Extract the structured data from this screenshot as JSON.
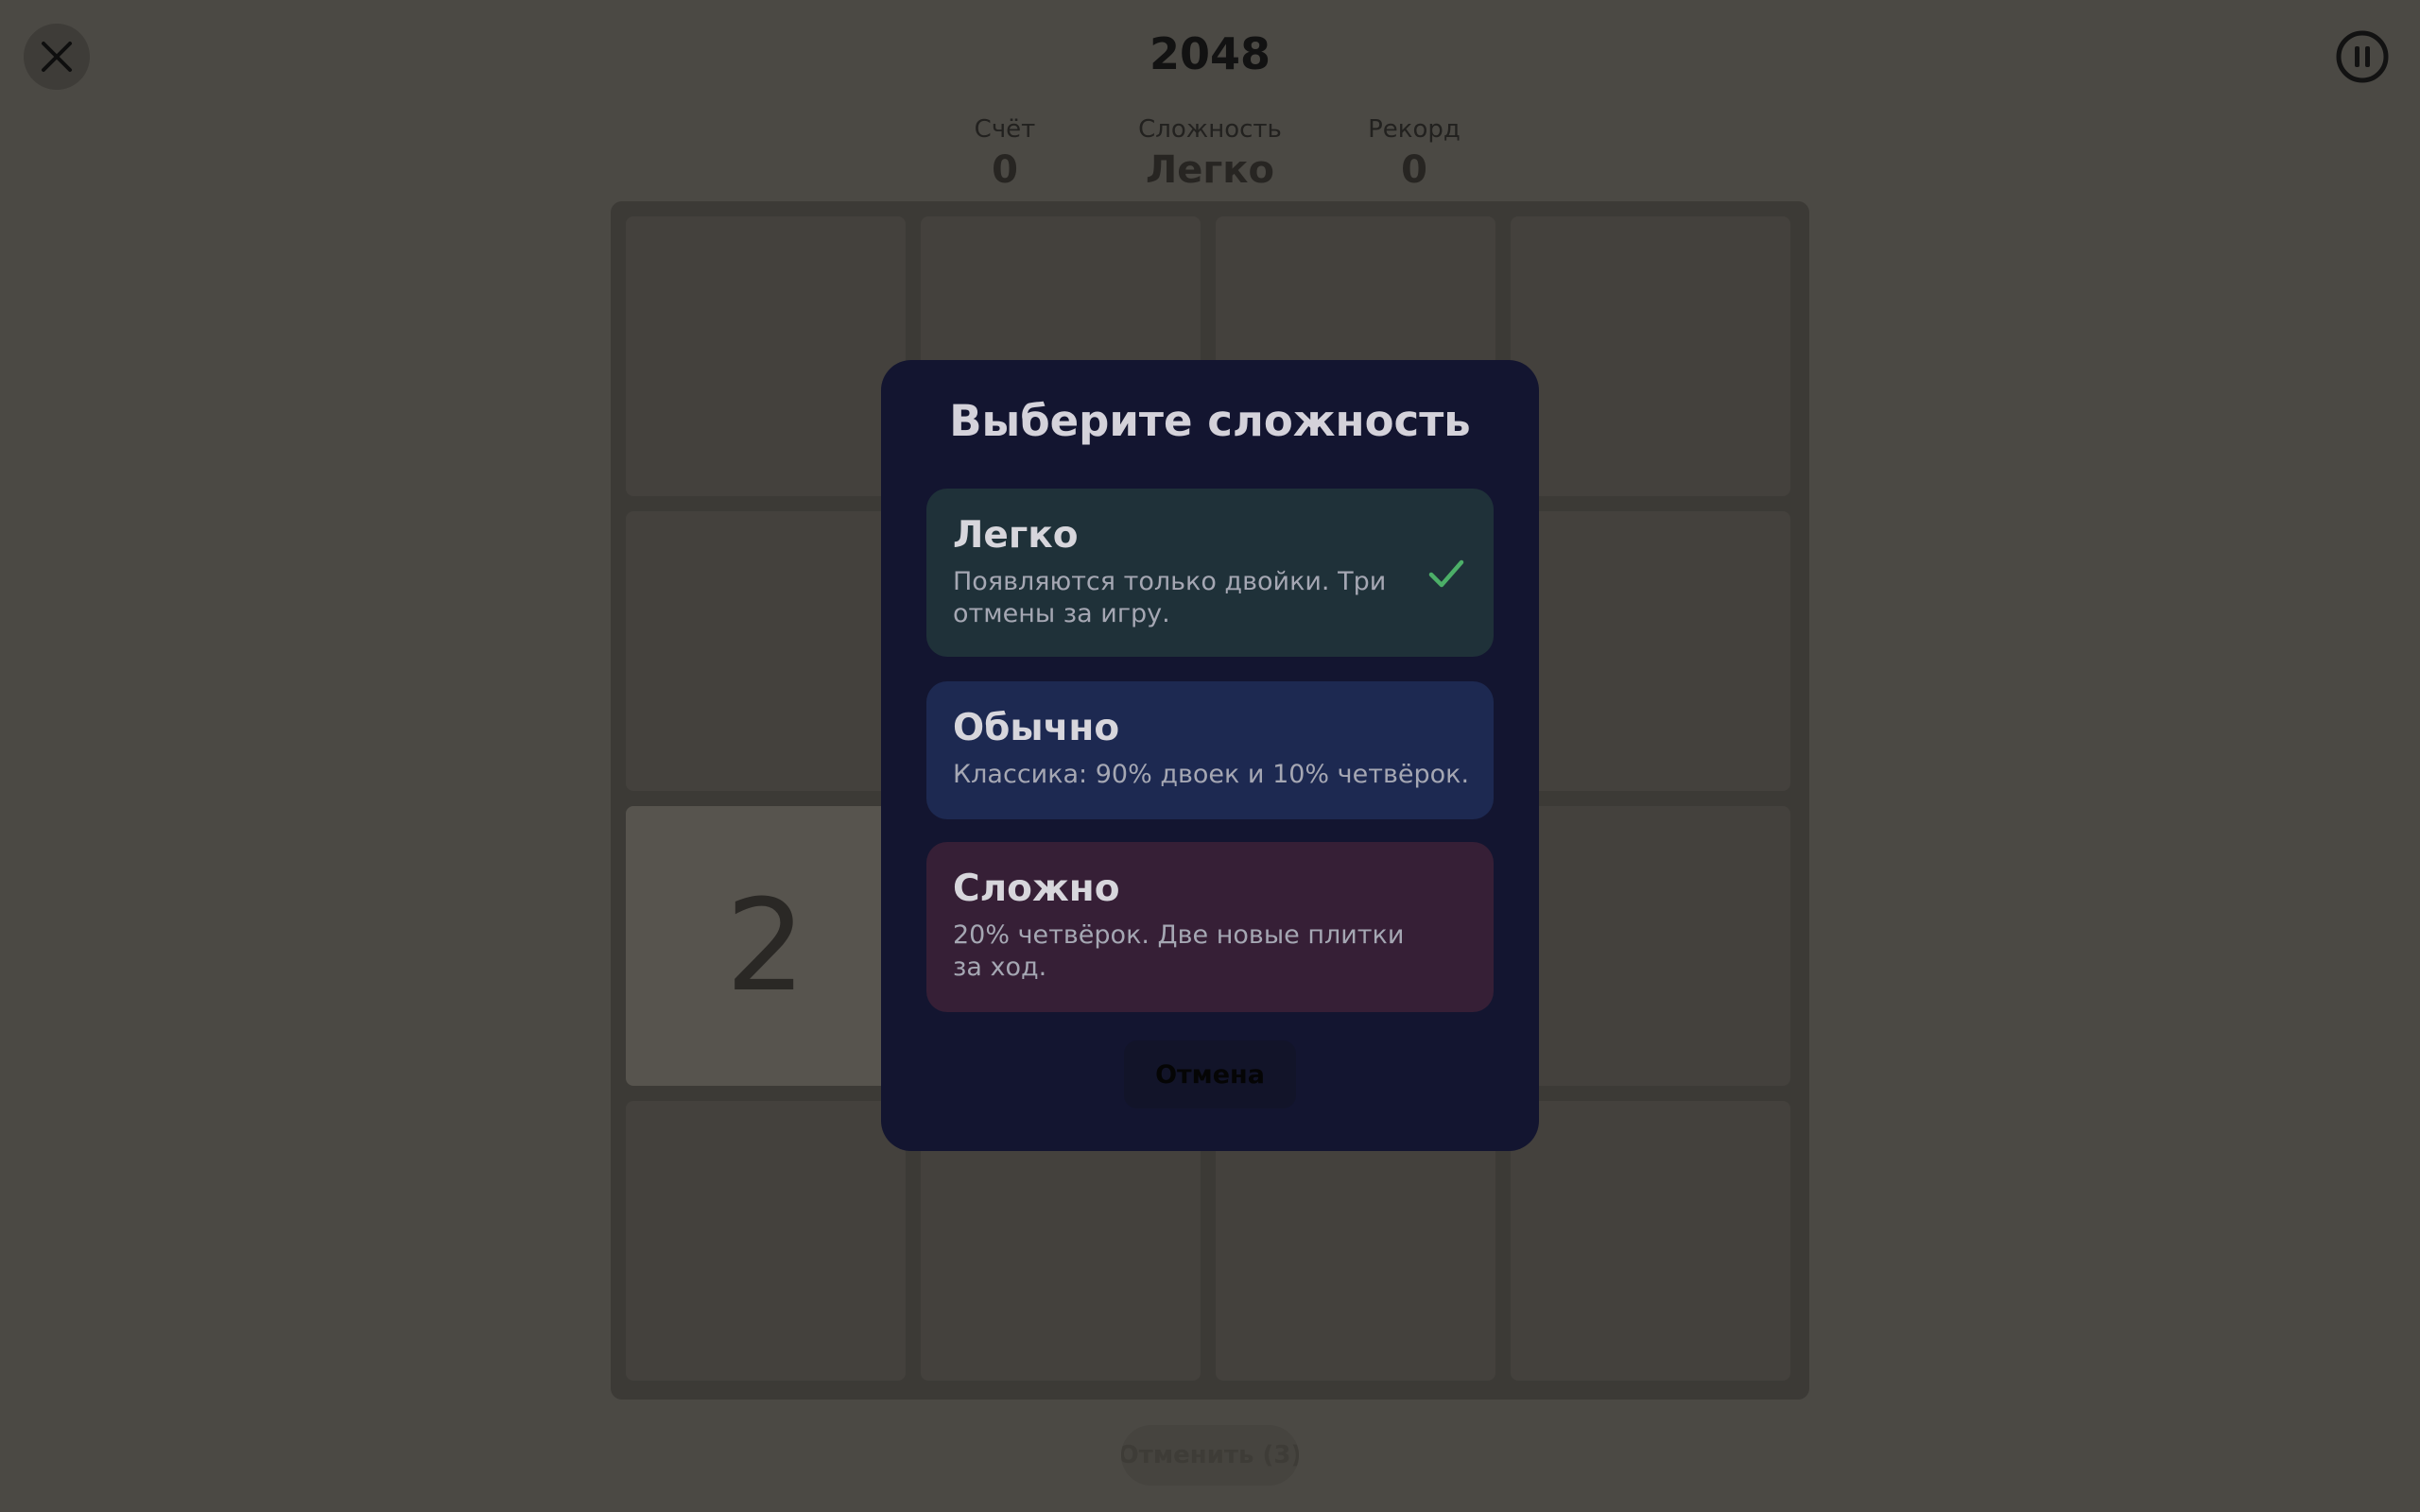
{
  "header": {
    "title": "2048",
    "close_icon": "close-icon",
    "pause_icon": "pause-icon"
  },
  "stats": {
    "score_label": "Счёт",
    "score_value": "0",
    "difficulty_label": "Сложность",
    "difficulty_value": "Легко",
    "record_label": "Рекорд",
    "record_value": "0"
  },
  "board": {
    "size": 4,
    "tiles": [
      [
        "",
        "",
        "",
        ""
      ],
      [
        "",
        "",
        "",
        ""
      ],
      [
        "2",
        "",
        "",
        ""
      ],
      [
        "",
        "",
        "",
        ""
      ]
    ]
  },
  "undo": {
    "label": "Отменить (3)"
  },
  "modal": {
    "title": "Выберите сложность",
    "options": [
      {
        "name": "Легко",
        "description": "Появляются только двойки. Три отмены за игру.",
        "selected": true
      },
      {
        "name": "Обычно",
        "description": "Классика: 90% двоек и 10% четвёрок.",
        "selected": false
      },
      {
        "name": "Сложно",
        "description": "20% четвёрок. Две новые плитки за ход.",
        "selected": false
      }
    ],
    "cancel_label": "Отмена"
  },
  "colors": {
    "overlay_background": "#4b4944",
    "modal_background": "#131530",
    "easy_background": "#1f3139",
    "normal_background": "#1d2951",
    "hard_background": "#361f36",
    "check_color": "#4caf68"
  }
}
